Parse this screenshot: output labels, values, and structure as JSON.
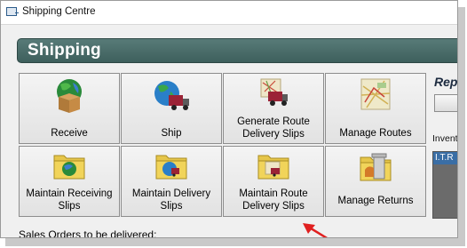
{
  "window": {
    "title": "Shipping Centre"
  },
  "header": {
    "title": "Shipping"
  },
  "tiles": [
    {
      "label": "Receive",
      "icon": "globe-box-icon"
    },
    {
      "label": "Ship",
      "icon": "globe-truck-icon"
    },
    {
      "label": "Generate Route Delivery Slips",
      "icon": "map-truck-icon"
    },
    {
      "label": "Manage Routes",
      "icon": "road-map-icon"
    },
    {
      "label": "Maintain Receiving Slips",
      "icon": "folder-globe-icon"
    },
    {
      "label": "Maintain Delivery Slips",
      "icon": "folder-globe-truck-icon"
    },
    {
      "label": "Maintain Route Delivery Slips",
      "icon": "folder-map-truck-icon"
    },
    {
      "label": "Manage Returns",
      "icon": "folder-trash-icon"
    }
  ],
  "right_panel": {
    "reports_label": "Repo",
    "inventory_label": "Invent",
    "list_item": "I.T.R"
  },
  "footer": {
    "sales_orders_label": "Sales Orders to be delivered:"
  },
  "colors": {
    "header_bg": "#4a6b68",
    "annotation_arrow": "#e02020"
  }
}
